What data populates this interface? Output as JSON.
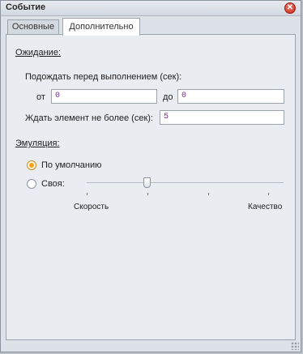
{
  "window": {
    "title": "Событие",
    "close_icon": "close-icon"
  },
  "tabs": [
    {
      "label": "Основные",
      "active": false
    },
    {
      "label": "Дополнительно",
      "active": true
    }
  ],
  "wait": {
    "section_label": "Ожидание:",
    "before_label": "Подождать перед выполнением (сек):",
    "from_label": "от",
    "from_value": "0",
    "to_label": "до",
    "to_value": "0",
    "max_label": "Ждать элемент не более (сек):",
    "max_value": "5"
  },
  "emulation": {
    "section_label": "Эмуляция:",
    "options": [
      {
        "label": "По умолчанию",
        "checked": true
      },
      {
        "label": "Своя:",
        "checked": false
      }
    ],
    "slider": {
      "min_label": "Скорость",
      "max_label": "Качество",
      "value_fraction": 0.31
    }
  },
  "colors": {
    "accent_radio": "#f3a21e",
    "input_text": "#7a2b8a"
  }
}
